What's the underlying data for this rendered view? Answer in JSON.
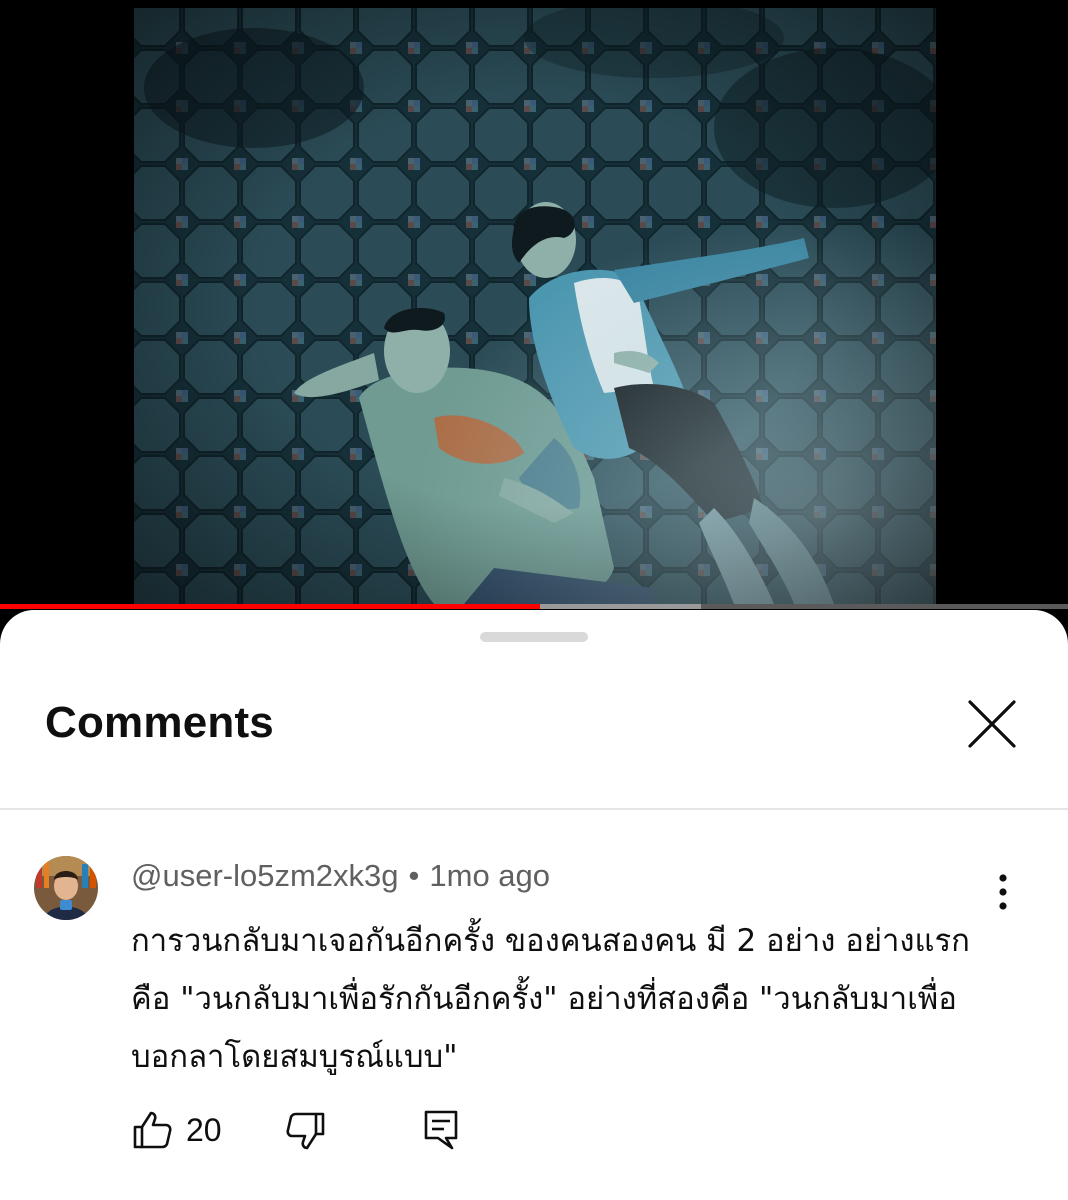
{
  "video": {
    "progress_played": 0.506,
    "progress_buffered": 0.656
  },
  "colors": {
    "progress": "#ff0000",
    "background": "#ffffff",
    "text": "#0f0f0f",
    "meta": "#606060"
  },
  "comments_panel": {
    "title": "Comments",
    "close_icon": "close-icon"
  },
  "comment": {
    "author": "@user-lo5zm2xk3g",
    "separator": "•",
    "time": "1mo ago",
    "lines": [
      "การวนกลับมาเจอกันอีกครั้ง ของคนสองคน มี 2 อย่าง อย่างแรก",
      "คือ \"วนกลับมาเพื่อรักกันอีกครั้ง\" อย่างที่สองคือ \"วนกลับมาเพื่อ",
      "บอกลาโดยสมบูรณ์แบบ\""
    ],
    "like_count": "20",
    "icons": [
      "thumb-up-icon",
      "thumb-down-icon",
      "reply-icon",
      "more-vert-icon"
    ]
  }
}
